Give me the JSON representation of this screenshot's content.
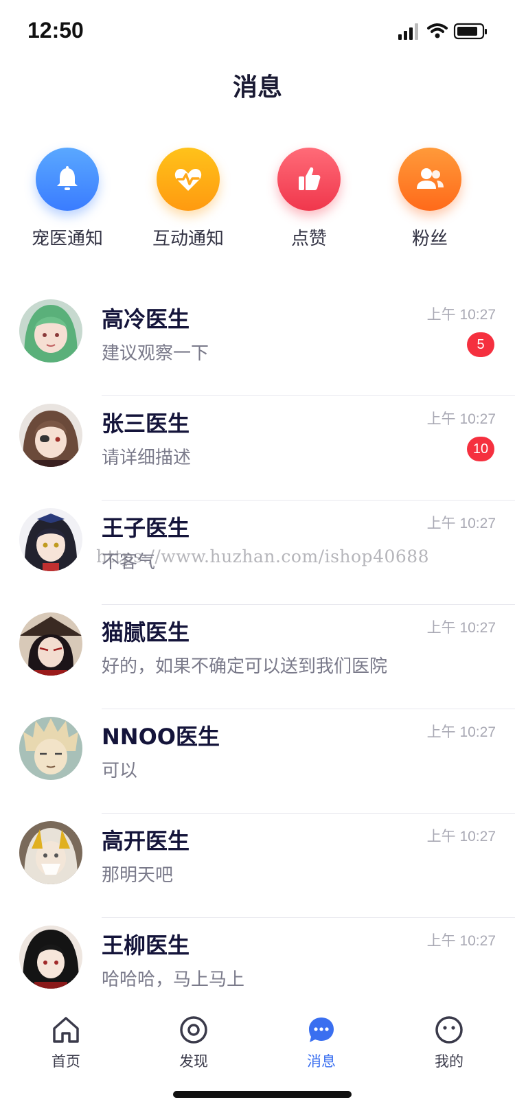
{
  "status": {
    "time": "12:50"
  },
  "header": {
    "title": "消息"
  },
  "quick_actions": [
    {
      "label": "宠医通知",
      "icon": "bell-icon",
      "color": "#3f8cff"
    },
    {
      "label": "互动通知",
      "icon": "heartbeat-icon",
      "color": "#ffa81a"
    },
    {
      "label": "点赞",
      "icon": "thumbs-up-icon",
      "color": "#f8465a"
    },
    {
      "label": "粉丝",
      "icon": "users-icon",
      "color": "#ff7a2a"
    }
  ],
  "messages": [
    {
      "name": "高冷医生",
      "preview": "建议观察一下",
      "time": "上午 10:27",
      "badge": "5"
    },
    {
      "name": "张三医生",
      "preview": "请详细描述",
      "time": "上午 10:27",
      "badge": "10"
    },
    {
      "name": "王子医生",
      "preview": "不客气",
      "time": "上午 10:27"
    },
    {
      "name": "猫腻医生",
      "preview": "好的，如果不确定可以送到我们医院",
      "time": "上午 10:27"
    },
    {
      "name": "NNOO医生",
      "preview": "可以",
      "time": "上午 10:27"
    },
    {
      "name": "高开医生",
      "preview": "那明天吧",
      "time": "上午 10:27"
    },
    {
      "name": "王柳医生",
      "preview": "哈哈哈，马上马上",
      "time": "上午 10:27"
    }
  ],
  "watermark": "https://www.huzhan.com/ishop40688",
  "tabbar": {
    "items": [
      {
        "label": "首页",
        "icon": "home-icon"
      },
      {
        "label": "发现",
        "icon": "discover-icon"
      },
      {
        "label": "消息",
        "icon": "chat-icon",
        "active": true
      },
      {
        "label": "我的",
        "icon": "profile-icon"
      }
    ]
  },
  "colors": {
    "accent": "#3a6ff0",
    "badge": "#f5303f"
  }
}
